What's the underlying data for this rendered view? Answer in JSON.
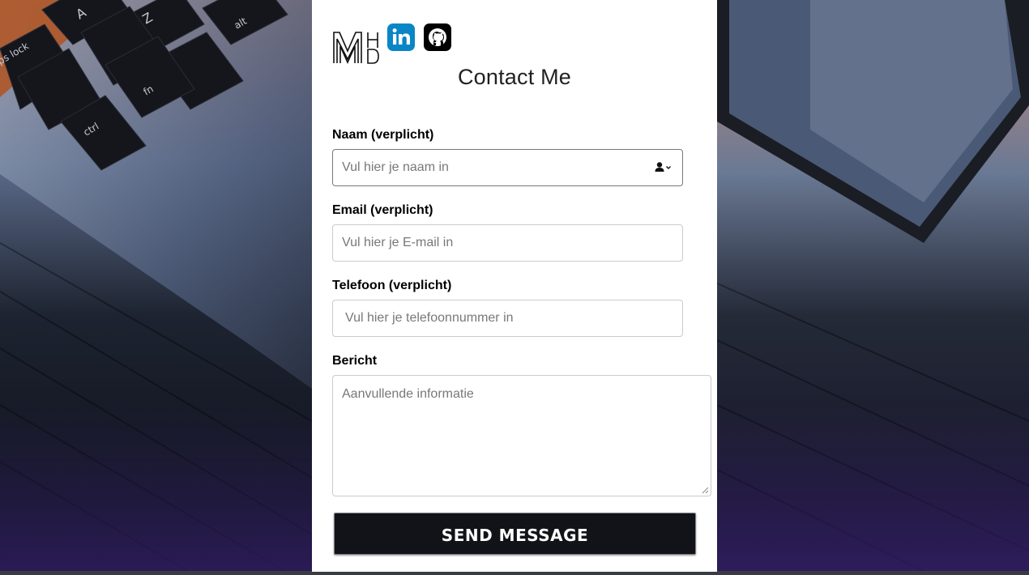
{
  "form": {
    "title": "Contact Me",
    "name_label": "Naam (verplicht)",
    "name_placeholder": "Vul hier je naam in",
    "email_label": "Email (verplicht)",
    "email_placeholder": "Vul hier je E-mail in",
    "phone_label": "Telefoon (verplicht)",
    "phone_placeholder": "Vul hier je telefoonnummer in",
    "message_label": "Bericht",
    "message_placeholder": "Aanvullende informatie",
    "send_label": "SEND MESSAGE"
  },
  "logo": {
    "text": "MHD"
  },
  "icons": {
    "linkedin": "linkedin-icon",
    "github": "github-icon",
    "autofill": "contact-autofill-icon"
  },
  "colors": {
    "linkedin": "#0a86c6",
    "github": "#000000",
    "button": "#121318"
  }
}
